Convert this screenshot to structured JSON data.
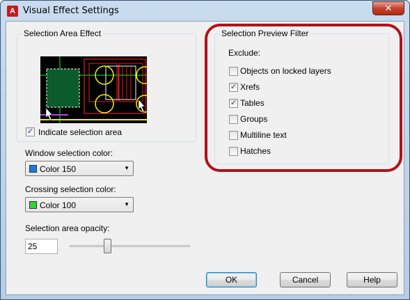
{
  "window": {
    "title": "Visual Effect Settings",
    "close_glyph": "✕",
    "app_icon_letter": "A"
  },
  "selection_area_effect": {
    "group_label": "Selection Area Effect",
    "indicate_label": "Indicate selection area",
    "indicate_checked": true
  },
  "window_selection": {
    "label": "Window selection color:",
    "value": "Color 150",
    "swatch": "#1e78e0"
  },
  "crossing_selection": {
    "label": "Crossing selection color:",
    "value": "Color 100",
    "swatch": "#33d433"
  },
  "opacity": {
    "label": "Selection area opacity:",
    "value": "25",
    "slider_fraction": 0.4
  },
  "filter": {
    "group_label": "Selection Preview Filter",
    "exclude_label": "Exclude:",
    "items": [
      {
        "label": "Objects on locked layers",
        "checked": false
      },
      {
        "label": "Xrefs",
        "checked": true
      },
      {
        "label": "Tables",
        "checked": true
      },
      {
        "label": "Groups",
        "checked": false
      },
      {
        "label": "Multiline text",
        "checked": false
      },
      {
        "label": "Hatches",
        "checked": false
      }
    ]
  },
  "buttons": {
    "ok": "OK",
    "cancel": "Cancel",
    "help": "Help"
  },
  "colors": {
    "highlight": "#b0121a"
  }
}
